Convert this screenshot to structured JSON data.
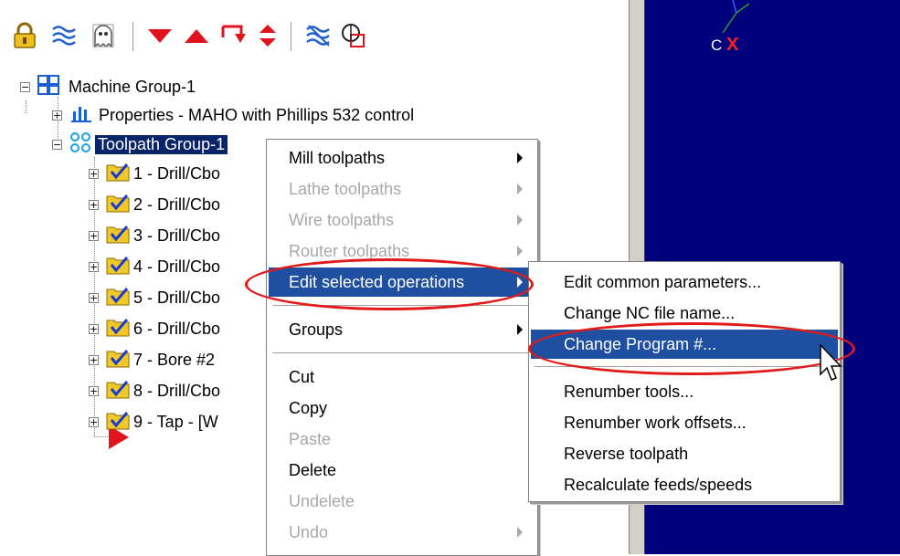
{
  "toolbar": {
    "icons": [
      "lock-icon",
      "toolpath-wave-icon",
      "ghost-icon",
      "move-down-icon",
      "move-up-icon",
      "insert-arrow-icon",
      "scroll-icon",
      "regen-wave-icon",
      "verify-icon"
    ]
  },
  "tree": {
    "machine_group": "Machine Group-1",
    "properties": "Properties - MAHO with Phillips 532 control",
    "toolpath_group": "Toolpath Group-1",
    "operations": [
      "1 - Drill/Cbo",
      "2 - Drill/Cbo",
      "3 - Drill/Cbo",
      "4 - Drill/Cbo",
      "5 - Drill/Cbo",
      "6 - Drill/Cbo",
      "7 - Bore #2",
      "8 - Drill/Cbo",
      "9 - Tap - [W"
    ]
  },
  "context_menu": {
    "items": [
      {
        "label": "Mill toolpaths",
        "disabled": false,
        "submenu": true
      },
      {
        "label": "Lathe toolpaths",
        "disabled": true,
        "submenu": true
      },
      {
        "label": "Wire toolpaths",
        "disabled": true,
        "submenu": true
      },
      {
        "label": "Router toolpaths",
        "disabled": true,
        "submenu": true
      },
      {
        "label": "Edit selected operations",
        "disabled": false,
        "submenu": true,
        "highlighted": true
      },
      {
        "label": "Groups",
        "disabled": false,
        "submenu": true
      },
      {
        "label": "Cut",
        "disabled": false
      },
      {
        "label": "Copy",
        "disabled": false
      },
      {
        "label": "Paste",
        "disabled": true
      },
      {
        "label": "Delete",
        "disabled": false
      },
      {
        "label": "Undelete",
        "disabled": true
      },
      {
        "label": "Undo",
        "disabled": true,
        "submenu": true
      }
    ]
  },
  "submenu": {
    "items": [
      {
        "label": "Edit common parameters..."
      },
      {
        "label": "Change NC file name..."
      },
      {
        "label": "Change Program #...",
        "highlighted": true
      },
      {
        "label": "Renumber tools..."
      },
      {
        "label": "Renumber work offsets..."
      },
      {
        "label": "Reverse toolpath"
      },
      {
        "label": "Recalculate feeds/speeds"
      }
    ]
  },
  "viewport": {
    "axis_c": "C",
    "axis_x": "X"
  },
  "colors": {
    "viewport_bg": "#00007c",
    "highlight": "#1e4fa0",
    "annotation": "#e21a1a"
  }
}
